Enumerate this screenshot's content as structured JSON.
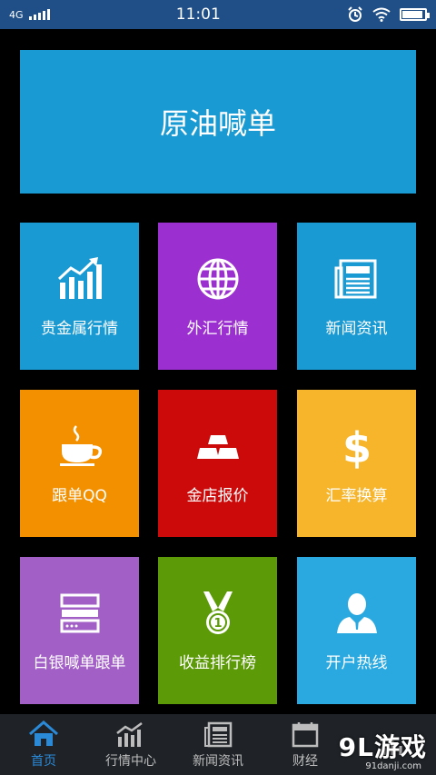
{
  "status": {
    "network": "4G",
    "time": "11:01"
  },
  "banner": {
    "label": "原油喊单"
  },
  "tiles": [
    {
      "label": "贵金属行情",
      "icon": "chart-bars-icon",
      "color": "#1a9ad3"
    },
    {
      "label": "外汇行情",
      "icon": "globe-icon",
      "color": "#9b2fcf"
    },
    {
      "label": "新闻资讯",
      "icon": "newspaper-icon",
      "color": "#1a9ad3"
    },
    {
      "label": "跟单QQ",
      "icon": "coffee-cup-icon",
      "color": "#f39000"
    },
    {
      "label": "金店报价",
      "icon": "gold-bars-icon",
      "color": "#cc0a0a"
    },
    {
      "label": "汇率换算",
      "icon": "dollar-icon",
      "color": "#f7b52b"
    },
    {
      "label": "白银喊单跟单",
      "icon": "server-icon",
      "color": "#a25fc6"
    },
    {
      "label": "收益排行榜",
      "icon": "medal-icon",
      "color": "#5c9a08"
    },
    {
      "label": "开户热线",
      "icon": "user-icon",
      "color": "#2aa8e0"
    }
  ],
  "tabbar": [
    {
      "label": "首页",
      "icon": "home-icon",
      "active": true
    },
    {
      "label": "行情中心",
      "icon": "chart-bars-icon",
      "active": false
    },
    {
      "label": "新闻资讯",
      "icon": "newspaper-icon",
      "active": false
    },
    {
      "label": "财经",
      "icon": "calendar-icon",
      "active": false
    },
    {
      "label": "",
      "icon": "more-icon",
      "active": false
    }
  ],
  "watermark": {
    "logo": "9L游戏",
    "url": "91danji.com"
  }
}
